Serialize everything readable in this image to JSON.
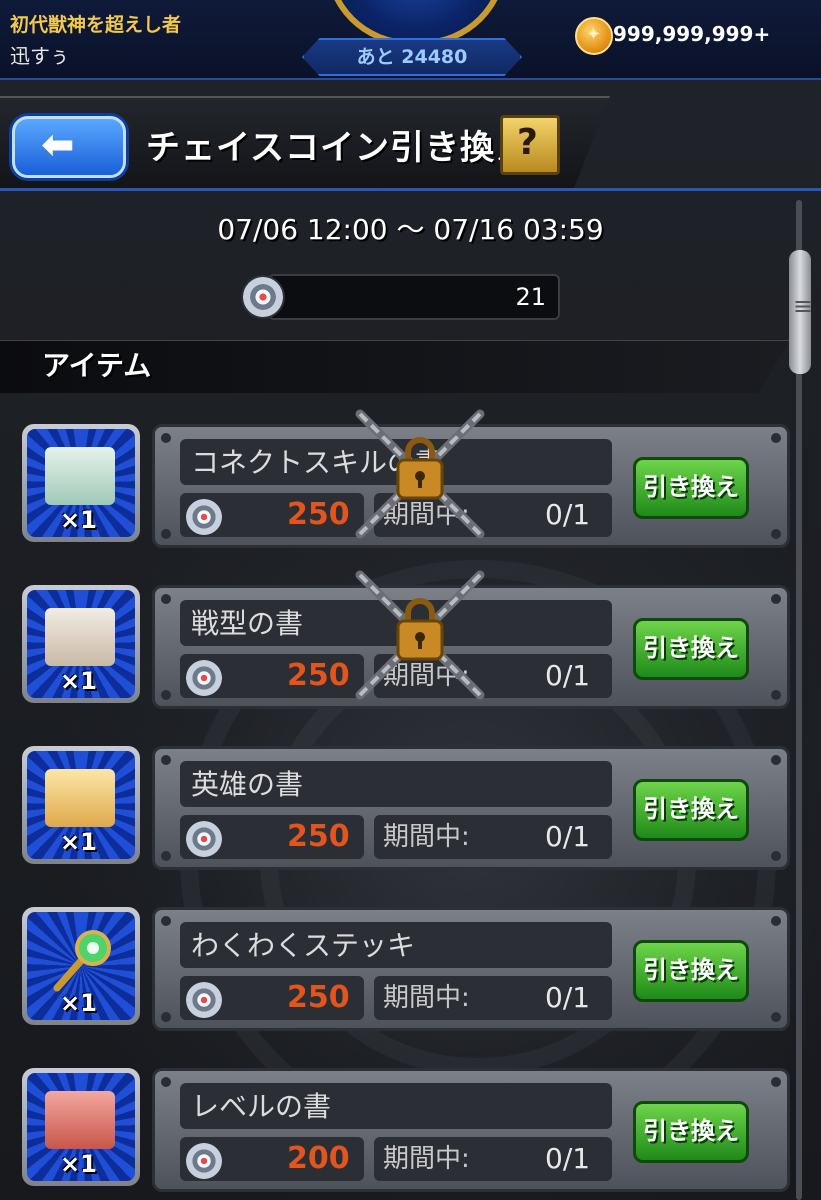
{
  "topbar": {
    "title": "初代獣神を超えし者",
    "player_name": "迅すぅ",
    "counter_text": "あと 24480",
    "gold_amount": "999,999,999+"
  },
  "header": {
    "back_icon": "back-arrow-icon",
    "title": "チェイスコイン引き換え",
    "help_label": "?"
  },
  "event": {
    "period": "07/06 12:00 ～ 07/16 03:59",
    "coin_count": "21"
  },
  "section": {
    "label": "アイテム"
  },
  "items": [
    {
      "name": "コネクトスキルの書",
      "quantity": "×1",
      "cost": "250",
      "limit_label": "期間中:",
      "limit": "0/1",
      "button": "引き換え",
      "locked": true
    },
    {
      "name": "戦型の書",
      "quantity": "×1",
      "cost": "250",
      "limit_label": "期間中:",
      "limit": "0/1",
      "button": "引き換え",
      "locked": true
    },
    {
      "name": "英雄の書",
      "quantity": "×1",
      "cost": "250",
      "limit_label": "期間中:",
      "limit": "0/1",
      "button": "引き換え",
      "locked": false
    },
    {
      "name": "わくわくステッキ",
      "quantity": "×1",
      "cost": "250",
      "limit_label": "期間中:",
      "limit": "0/1",
      "button": "引き換え",
      "locked": false
    },
    {
      "name": "レベルの書",
      "quantity": "×1",
      "cost": "200",
      "limit_label": "期間中:",
      "limit": "0/1",
      "button": "引き換え",
      "locked": false
    }
  ]
}
